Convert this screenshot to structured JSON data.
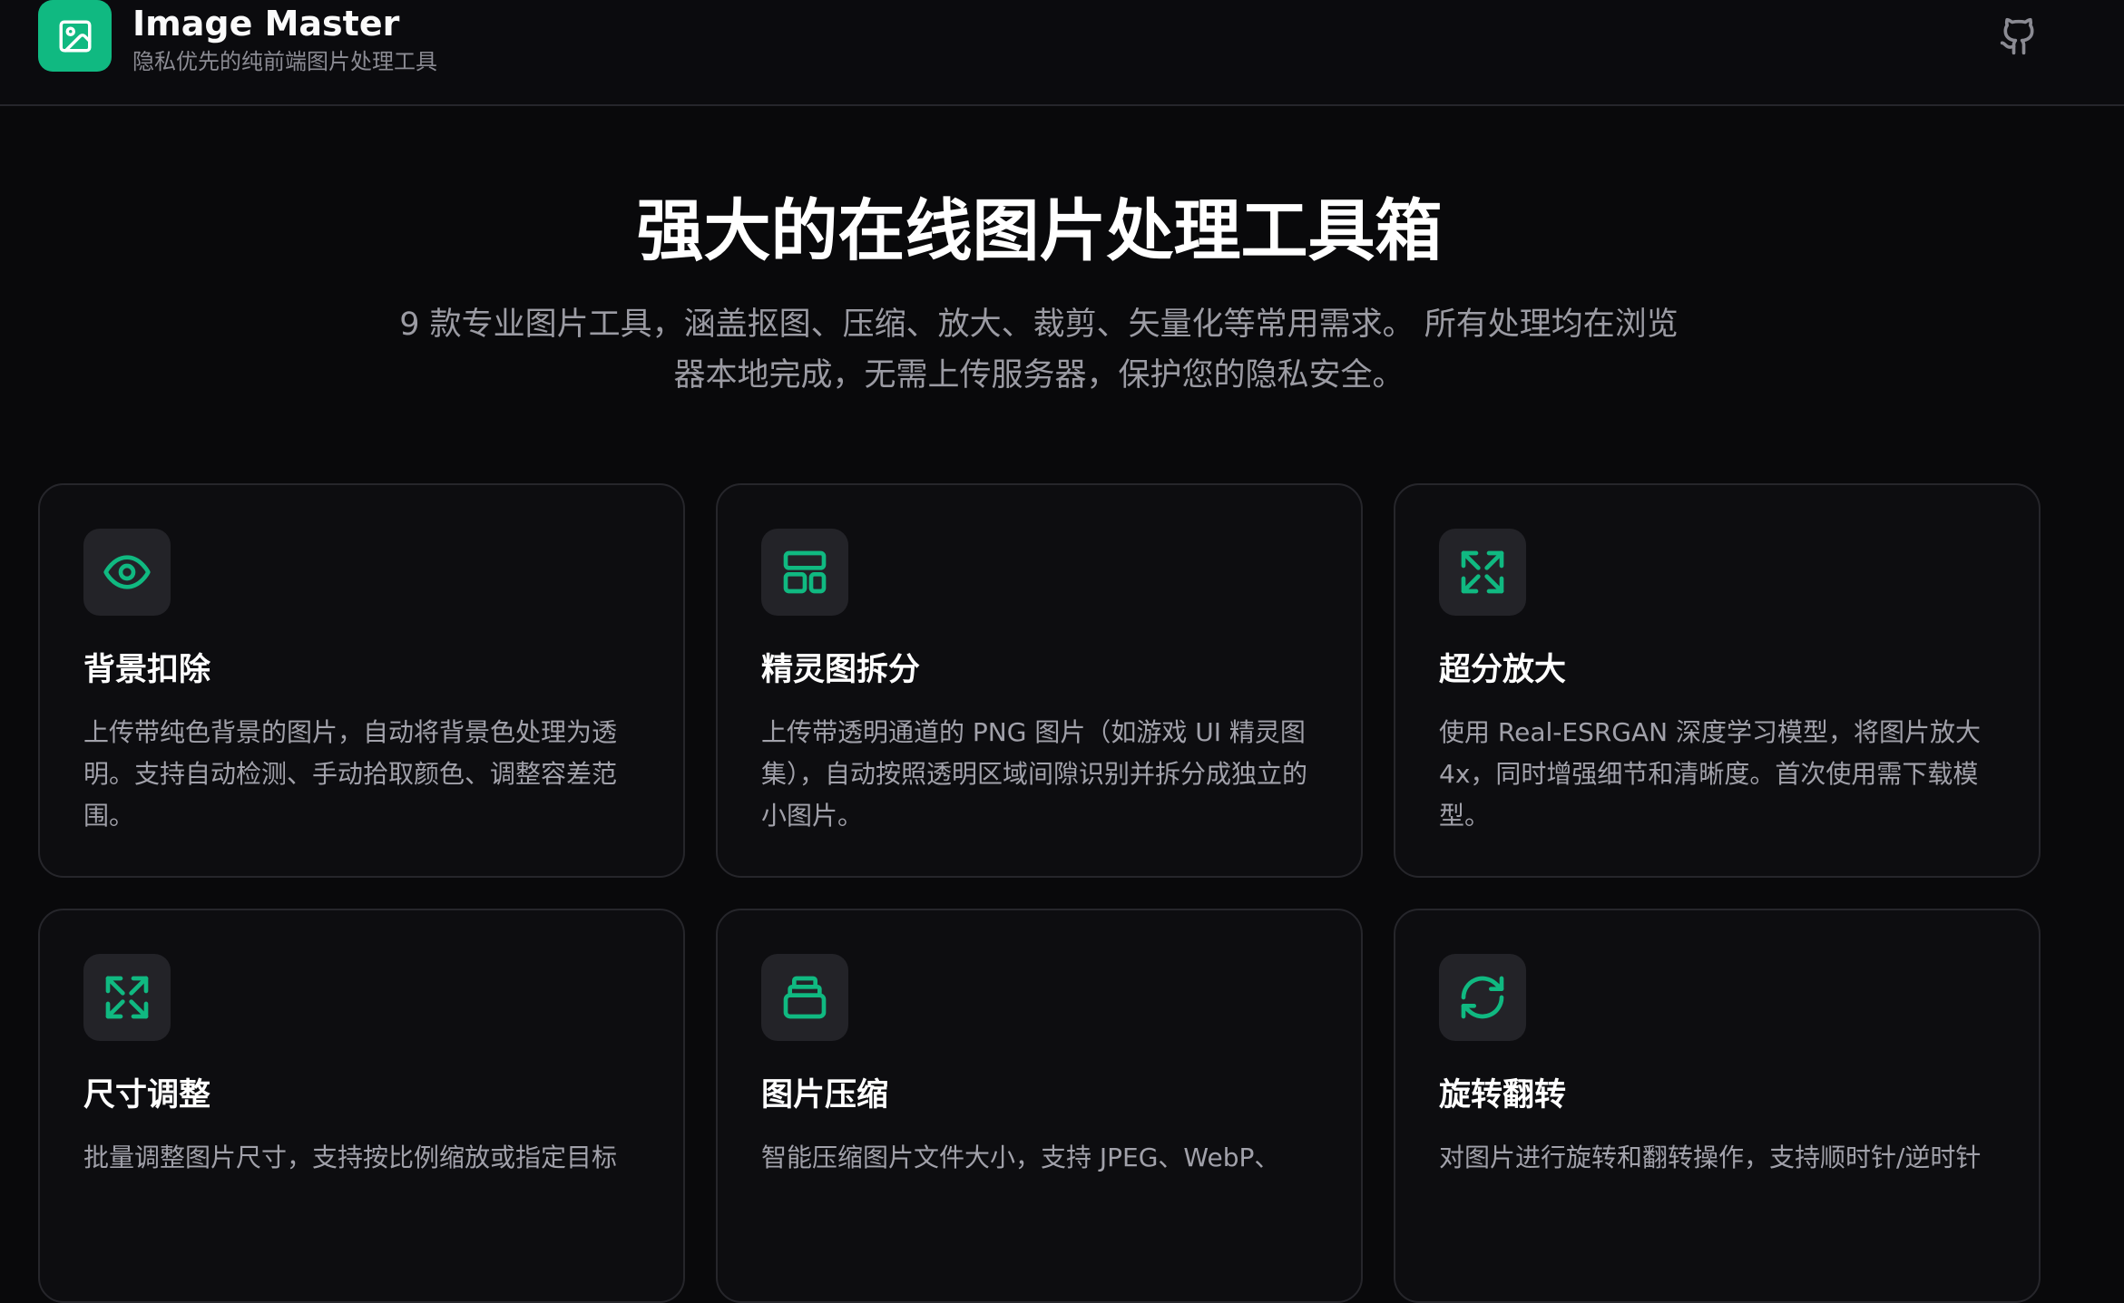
{
  "header": {
    "app_title": "Image Master",
    "app_subtitle": "隐私优先的纯前端图片处理工具",
    "logo_icon": "image-icon",
    "github_icon": "github-icon"
  },
  "hero": {
    "title": "强大的在线图片处理工具箱",
    "description": "9 款专业图片工具，涵盖抠图、压缩、放大、裁剪、矢量化等常用需求。 所有处理均在浏览器本地完成，无需上传服务器，保护您的隐私安全。"
  },
  "colors": {
    "accent": "#10b981",
    "background": "#09090b",
    "card_border": "#26262b",
    "icon_bg": "#232328"
  },
  "tools": [
    {
      "title": "背景扣除",
      "description": "上传带纯色背景的图片，自动将背景色处理为透明。支持自动检测、手动拾取颜色、调整容差范围。",
      "icon": "eye-icon"
    },
    {
      "title": "精灵图拆分",
      "description": "上传带透明通道的 PNG 图片（如游戏 UI 精灵图集），自动按照透明区域间隙识别并拆分成独立的小图片。",
      "icon": "layout-icon"
    },
    {
      "title": "超分放大",
      "description": "使用 Real-ESRGAN 深度学习模型，将图片放大 4x，同时增强细节和清晰度。首次使用需下载模型。",
      "icon": "expand-icon"
    },
    {
      "title": "尺寸调整",
      "description": "批量调整图片尺寸，支持按比例缩放或指定目标",
      "icon": "expand-icon"
    },
    {
      "title": "图片压缩",
      "description": "智能压缩图片文件大小，支持 JPEG、WebP、",
      "icon": "archive-icon"
    },
    {
      "title": "旋转翻转",
      "description": "对图片进行旋转和翻转操作，支持顺时针/逆时针",
      "icon": "rotate-icon"
    }
  ]
}
